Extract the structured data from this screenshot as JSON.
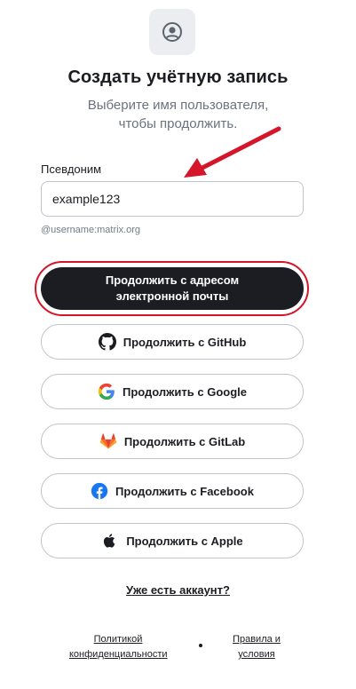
{
  "header": {
    "avatar_icon": "user-circle-icon",
    "title": "Создать учётную запись",
    "subtitle_line1": "Выберите имя пользователя,",
    "subtitle_line2": "чтобы продолжить."
  },
  "username": {
    "label": "Псевдоним",
    "value": "example123",
    "hint": "@username:matrix.org"
  },
  "email_button": {
    "label": "Продолжить с адресом электронной почты"
  },
  "sso_buttons": [
    {
      "label": "Продолжить с GitHub",
      "icon": "github-icon"
    },
    {
      "label": "Продолжить с Google",
      "icon": "google-icon"
    },
    {
      "label": "Продолжить с GitLab",
      "icon": "gitlab-icon"
    },
    {
      "label": "Продолжить с Facebook",
      "icon": "facebook-icon"
    },
    {
      "label": "Продолжить с Apple",
      "icon": "apple-icon"
    }
  ],
  "signin_link": "Уже есть аккаунт?",
  "footer": {
    "privacy_line1": "Политикой",
    "privacy_line2": "конфиденциальности",
    "terms_line1": "Правила и",
    "terms_line2": "условия"
  },
  "annotation": {
    "arrow_color": "#d4152a",
    "highlight_color": "#d4152a"
  },
  "colors": {
    "primary_button": "#1b1d22",
    "border": "#c0c4cb",
    "muted_text": "#6c737e"
  }
}
